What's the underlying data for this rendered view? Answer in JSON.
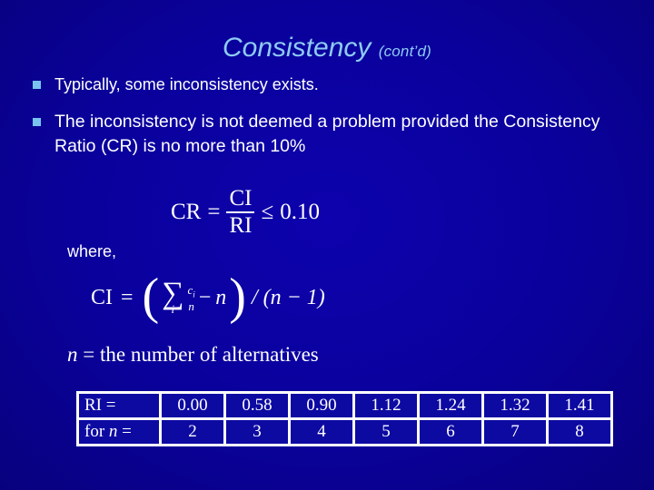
{
  "slide": {
    "background_color": "#0a019b",
    "title": {
      "main": "Consistency",
      "suffix": "(cont’d)",
      "color": "#8fcbf2"
    },
    "bullets": [
      {
        "marker": "square-bullet",
        "text": "Typically, some inconsistency exists."
      },
      {
        "marker": "square-bullet",
        "text": "The inconsistency is not deemed a problem provided the Consistency Ratio (CR) is no more than 10%"
      }
    ],
    "bullet_color": "#79c3ef",
    "equations": {
      "cr": {
        "lhs": "CR",
        "equals": "=",
        "numerator": "CI",
        "denominator": "RI",
        "relation": "≤",
        "rhs": "0.10",
        "plain": "CR = CI / RI ≤ 0.10"
      },
      "where_label": "where,",
      "ci": {
        "lhs": "CI",
        "equals": "=",
        "open_paren": "(",
        "sum_symbol": "∑",
        "sum_index": "i",
        "frac_numerator": "c",
        "frac_numerator_sub": "i",
        "frac_denominator": "n",
        "minus": "−",
        "minus_term": "n",
        "close_paren": ")",
        "tail": "/ (n − 1)",
        "plain": "CI = ( ∑i ci/n − n ) / (n − 1)"
      },
      "n_definition": {
        "symbol": "n",
        "equals": "=",
        "text": "the number of alternatives",
        "plain": "n = the number of alternatives"
      }
    },
    "table": {
      "rows": [
        {
          "header": "RI =",
          "values": [
            "0.00",
            "0.58",
            "0.90",
            "1.12",
            "1.24",
            "1.32",
            "1.41"
          ]
        },
        {
          "header_prefix": "for ",
          "header_symbol": "n",
          "header_suffix": " =",
          "values": [
            "2",
            "3",
            "4",
            "5",
            "6",
            "7",
            "8"
          ]
        }
      ],
      "border_color": "#ffffff",
      "cell_color": "#0d0aa2"
    }
  }
}
